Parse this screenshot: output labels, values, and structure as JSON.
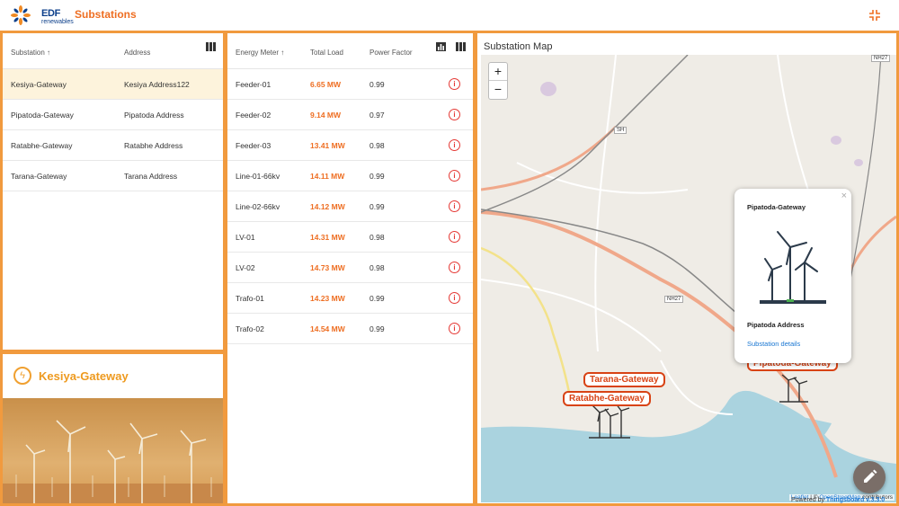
{
  "header": {
    "logo_text": "EDF",
    "logo_sub": "renewables",
    "title": "Substations"
  },
  "substations": {
    "columns": {
      "name": "Substation",
      "address": "Address"
    },
    "sort_indicator": "↑",
    "rows": [
      {
        "name": "Kesiya-Gateway",
        "address": "Kesiya Address122"
      },
      {
        "name": "Pipatoda-Gateway",
        "address": "Pipatoda Address"
      },
      {
        "name": "Ratabhe-Gateway",
        "address": "Ratabhe Address"
      },
      {
        "name": "Tarana-Gateway",
        "address": "Tarana Address"
      }
    ]
  },
  "detail": {
    "name": "Kesiya-Gateway"
  },
  "meters": {
    "columns": {
      "meter": "Energy Meter",
      "load": "Total Load",
      "pf": "Power Factor"
    },
    "sort_indicator": "↑",
    "rows": [
      {
        "meter": "Feeder-01",
        "load": "6.65 MW",
        "pf": "0.99"
      },
      {
        "meter": "Feeder-02",
        "load": "9.14 MW",
        "pf": "0.97"
      },
      {
        "meter": "Feeder-03",
        "load": "13.41 MW",
        "pf": "0.98"
      },
      {
        "meter": "Line-01-66kv",
        "load": "14.11 MW",
        "pf": "0.99"
      },
      {
        "meter": "Line-02-66kv",
        "load": "14.12 MW",
        "pf": "0.99"
      },
      {
        "meter": "LV-01",
        "load": "14.31 MW",
        "pf": "0.98"
      },
      {
        "meter": "LV-02",
        "load": "14.73 MW",
        "pf": "0.98"
      },
      {
        "meter": "Trafo-01",
        "load": "14.23 MW",
        "pf": "0.99"
      },
      {
        "meter": "Trafo-02",
        "load": "14.54 MW",
        "pf": "0.99"
      }
    ]
  },
  "map": {
    "title": "Substation Map",
    "zoom_in": "+",
    "zoom_out": "−",
    "markers": [
      "Tarana-Gateway",
      "Ratabhe-Gateway",
      "Pipatoda-Gateway"
    ],
    "popup": {
      "close": "×",
      "name": "Pipatoda-Gateway",
      "address": "Pipatoda Address",
      "link": "Substation details"
    },
    "road_labels": [
      "SH",
      "NH27",
      "NH27"
    ],
    "attribution": {
      "leaflet": "Leaflet",
      "sep": " | © ",
      "osm": "OpenStreetMap",
      "tail": " contributors"
    },
    "powered": {
      "prefix": "Powered by ",
      "brand": "Thingsboard v.3.3.0"
    }
  },
  "colors": {
    "accent": "#ee6e22",
    "panel_border": "#f19a3e",
    "selected_row": "#fdf3dc",
    "info": "#e53935",
    "link": "#1976d2",
    "water": "#aad3df"
  }
}
